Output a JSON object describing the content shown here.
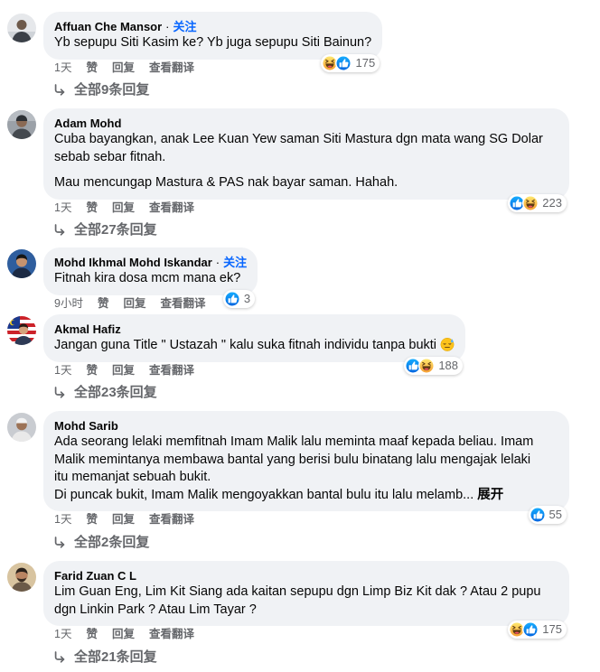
{
  "colors": {
    "bubble_bg": "#f0f2f5",
    "text": "#050505",
    "secondary": "#65676b",
    "follow_link": "#0866ff",
    "like_blue": "#1877f2",
    "haha_yellow": "#f7b928"
  },
  "labels": {
    "like": "赞",
    "reply": "回复",
    "translate": "查看翻译",
    "follow": "关注",
    "dot": "·",
    "see_more": "展开"
  },
  "comments": [
    {
      "author": "Affuan Che Mansor",
      "follow": true,
      "paragraphs": [
        [
          "Yb sepupu Siti Kasim ke? Yb juga sepupu Siti Bainun?"
        ]
      ],
      "reactions": {
        "icons": [
          "haha-icon",
          "like-icon"
        ],
        "count": "175"
      },
      "time": "1天",
      "replies_label": "全部9条回复"
    },
    {
      "author": "Adam Mohd",
      "paragraphs": [
        [
          "Cuba bayangkan, anak Lee Kuan Yew saman Siti Mastura dgn mata wang SG Dolar",
          "sebab sebar fitnah."
        ],
        [
          "Mau mencungap Mastura & PAS nak bayar saman. Hahah."
        ]
      ],
      "reactions": {
        "icons": [
          "like-icon",
          "haha-icon"
        ],
        "count": "223"
      },
      "time": "1天",
      "replies_label": "全部27条回复"
    },
    {
      "author": "Mohd Ikhmal Mohd Iskandar",
      "follow": true,
      "paragraphs": [
        [
          "Fitnah kira dosa mcm mana ek?"
        ]
      ],
      "reactions": {
        "icons": [
          "like-icon"
        ],
        "count": "3"
      },
      "time": "9小时"
    },
    {
      "author": "Akmal Hafiz",
      "paragraphs": [
        [
          "Jangan guna Title \" Ustazah \" kalu suka fitnah individu tanpa bukti"
        ]
      ],
      "emoji_icon": "downcast-face-with-sweat-icon",
      "reactions": {
        "icons": [
          "like-icon",
          "haha-icon"
        ],
        "count": "188"
      },
      "time": "1天",
      "replies_label": "全部23条回复"
    },
    {
      "author": "Mohd Sarib",
      "paragraphs": [
        [
          "Ada seorang lelaki memfitnah Imam Malik lalu meminta maaf kepada beliau. Imam",
          "Malik memintanya membawa bantal yang berisi bulu binatang lalu mengajak lelaki",
          "itu memanjat sebuah bukit.",
          "Di puncak bukit, Imam Malik mengoyakkan bantal bulu itu lalu melamb..."
        ]
      ],
      "truncated": true,
      "reactions": {
        "icons": [
          "like-icon"
        ],
        "count": "55"
      },
      "time": "1天",
      "replies_label": "全部2条回复"
    },
    {
      "author": "Farid Zuan C L",
      "paragraphs": [
        [
          "Lim Guan Eng, Lim Kit Siang ada kaitan sepupu dgn Limp Biz Kit dak ? Atau 2 pupu",
          "dgn Linkin Park ? Atau Lim Tayar ?"
        ]
      ],
      "reactions": {
        "icons": [
          "haha-icon",
          "like-icon"
        ],
        "count": "175"
      },
      "time": "1天",
      "replies_label": "全部21条回复"
    }
  ]
}
